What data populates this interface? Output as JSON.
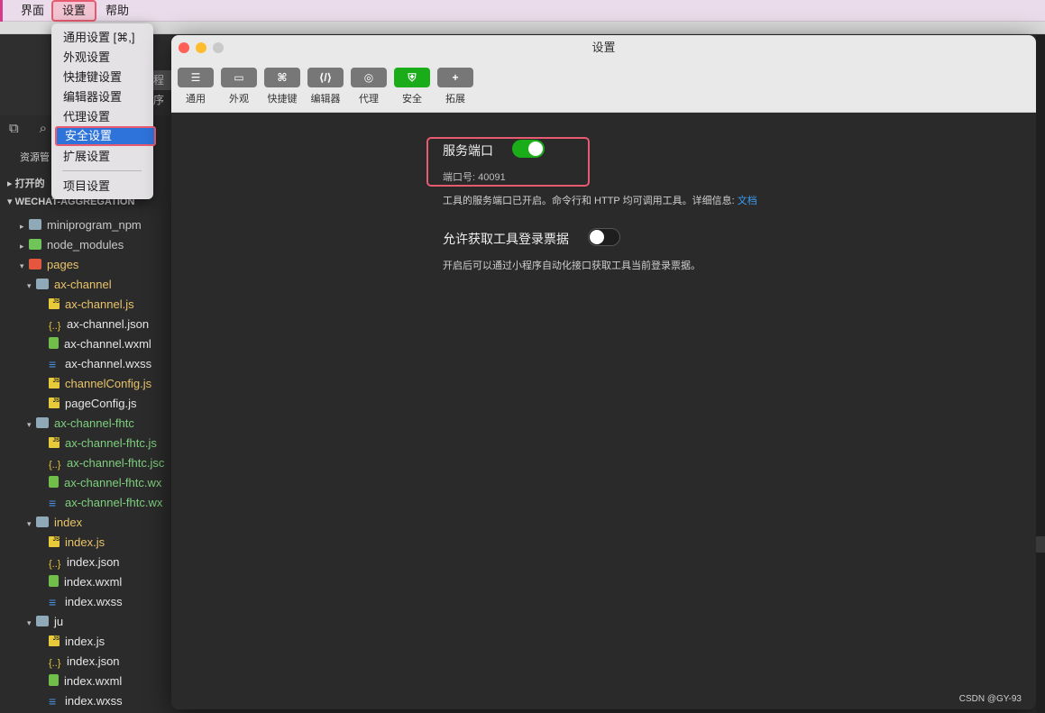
{
  "menubar": {
    "items": [
      "界面",
      "设置",
      "帮助"
    ]
  },
  "background_ide": {
    "partial_tab": "程序",
    "sidebar_title": "资源管",
    "open_section": "打开的",
    "project_name": "WECHAT-AGGREGATION",
    "tree": [
      {
        "label": "miniprogram_npm",
        "kind": "folder",
        "color": "grey",
        "depth": 1,
        "collapsed": true
      },
      {
        "label": "node_modules",
        "kind": "folder-green",
        "color": "grey",
        "depth": 1,
        "collapsed": true
      },
      {
        "label": "pages",
        "kind": "folder-red",
        "color": "yellow",
        "depth": 1,
        "collapsed": false
      },
      {
        "label": "ax-channel",
        "kind": "folder",
        "color": "yellow",
        "depth": 2,
        "collapsed": false
      },
      {
        "label": "ax-channel.js",
        "kind": "js",
        "color": "yellow",
        "depth": 3
      },
      {
        "label": "ax-channel.json",
        "kind": "json",
        "color": "white",
        "depth": 3
      },
      {
        "label": "ax-channel.wxml",
        "kind": "wxml",
        "color": "white",
        "depth": 3
      },
      {
        "label": "ax-channel.wxss",
        "kind": "wxss",
        "color": "white",
        "depth": 3
      },
      {
        "label": "channelConfig.js",
        "kind": "js",
        "color": "yellow",
        "depth": 3
      },
      {
        "label": "pageConfig.js",
        "kind": "js",
        "color": "white",
        "depth": 3
      },
      {
        "label": "ax-channel-fhtc",
        "kind": "folder",
        "color": "green",
        "depth": 2,
        "collapsed": false
      },
      {
        "label": "ax-channel-fhtc.js",
        "kind": "js",
        "color": "green",
        "depth": 3
      },
      {
        "label": "ax-channel-fhtc.jsc",
        "kind": "json",
        "color": "green",
        "depth": 3
      },
      {
        "label": "ax-channel-fhtc.wx",
        "kind": "wxml",
        "color": "green",
        "depth": 3
      },
      {
        "label": "ax-channel-fhtc.wx",
        "kind": "wxss",
        "color": "green",
        "depth": 3
      },
      {
        "label": "index",
        "kind": "folder",
        "color": "yellow",
        "depth": 2,
        "collapsed": false
      },
      {
        "label": "index.js",
        "kind": "js",
        "color": "yellow",
        "depth": 3
      },
      {
        "label": "index.json",
        "kind": "json",
        "color": "white",
        "depth": 3
      },
      {
        "label": "index.wxml",
        "kind": "wxml",
        "color": "white",
        "depth": 3
      },
      {
        "label": "index.wxss",
        "kind": "wxss",
        "color": "white",
        "depth": 3
      },
      {
        "label": "ju",
        "kind": "folder",
        "color": "white",
        "depth": 2,
        "collapsed": false
      },
      {
        "label": "index.js",
        "kind": "js",
        "color": "white",
        "depth": 3
      },
      {
        "label": "index.json",
        "kind": "json",
        "color": "white",
        "depth": 3
      },
      {
        "label": "index.wxml",
        "kind": "wxml",
        "color": "white",
        "depth": 3
      },
      {
        "label": "index.wxss",
        "kind": "wxss",
        "color": "white",
        "depth": 3
      }
    ]
  },
  "dropdown": {
    "items": [
      "通用设置 [⌘,]",
      "外观设置",
      "快捷键设置",
      "编辑器设置",
      "代理设置",
      "安全设置",
      "扩展设置",
      "项目设置"
    ],
    "selected": "安全设置"
  },
  "settings_window": {
    "title": "设置",
    "tabs": [
      {
        "label": "通用",
        "icon": "sliders-icon",
        "glyph": "☰"
      },
      {
        "label": "外观",
        "icon": "window-icon",
        "glyph": "▭"
      },
      {
        "label": "快捷键",
        "icon": "command-icon",
        "glyph": "⌘"
      },
      {
        "label": "编辑器",
        "icon": "code-icon",
        "glyph": "⟨/⟩"
      },
      {
        "label": "代理",
        "icon": "globe-icon",
        "glyph": "◎"
      },
      {
        "label": "安全",
        "icon": "shield-icon",
        "glyph": "⛨"
      },
      {
        "label": "拓展",
        "icon": "plus-icon",
        "glyph": "+"
      }
    ],
    "active_tab": "安全",
    "service_port": {
      "title": "服务端口",
      "enabled": true,
      "port_text": "端口号: 40091",
      "desc": "工具的服务端口已开启。命令行和 HTTP 均可调用工具。详细信息:",
      "link": "文档"
    },
    "login_ticket": {
      "title": "允许获取工具登录票据",
      "enabled": false,
      "desc": "开启后可以通过小程序自动化接口获取工具当前登录票据。"
    },
    "watermark": "CSDN @GY-93"
  },
  "colors": {
    "accent_green": "#1aad19",
    "highlight_red": "#e85a6f",
    "menu_selected": "#2e73d9",
    "link": "#3b9df2"
  }
}
